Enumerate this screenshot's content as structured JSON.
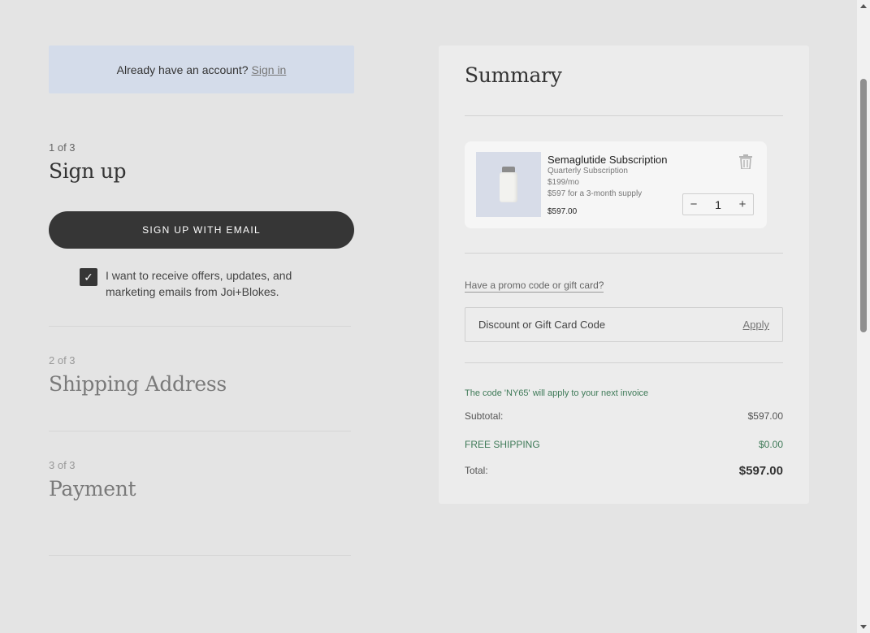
{
  "signin_banner": {
    "text": "Already have an account?",
    "link_label": "Sign in"
  },
  "steps": [
    {
      "count": "1 of 3",
      "title": "Sign up"
    },
    {
      "count": "2 of 3",
      "title": "Shipping Address"
    },
    {
      "count": "3 of 3",
      "title": "Payment"
    }
  ],
  "signup": {
    "email_button_label": "SIGN UP WITH EMAIL",
    "optin_checked": true,
    "optin_check_glyph": "✓",
    "optin_text": "I want to receive offers, updates, and marketing emails from Joi+Blokes."
  },
  "summary": {
    "title": "Summary",
    "product": {
      "name": "Semaglutide Subscription",
      "plan": "Quarterly Subscription",
      "monthly_price": "$199/mo",
      "supply_note": "$597 for a 3-month supply",
      "price": "$597.00",
      "quantity": "1",
      "qty_minus": "−",
      "qty_plus": "+",
      "delete_icon": "trash-icon"
    },
    "promo": {
      "link_label": "Have a promo code or gift card?",
      "placeholder": "Discount or Gift Card Code",
      "apply_label": "Apply"
    },
    "code_note": "The code 'NY65' will apply to your next invoice",
    "subtotal_label": "Subtotal:",
    "subtotal_value": "$597.00",
    "shipping_label": "FREE SHIPPING",
    "shipping_value": "$0.00",
    "total_label": "Total:",
    "total_value": "$597.00"
  },
  "colors": {
    "banner_bg": "#d4dcea",
    "button_bg": "#363636",
    "accent_green": "#3f7a58",
    "page_bg": "#e4e4e4",
    "panel_bg": "#ececec"
  }
}
